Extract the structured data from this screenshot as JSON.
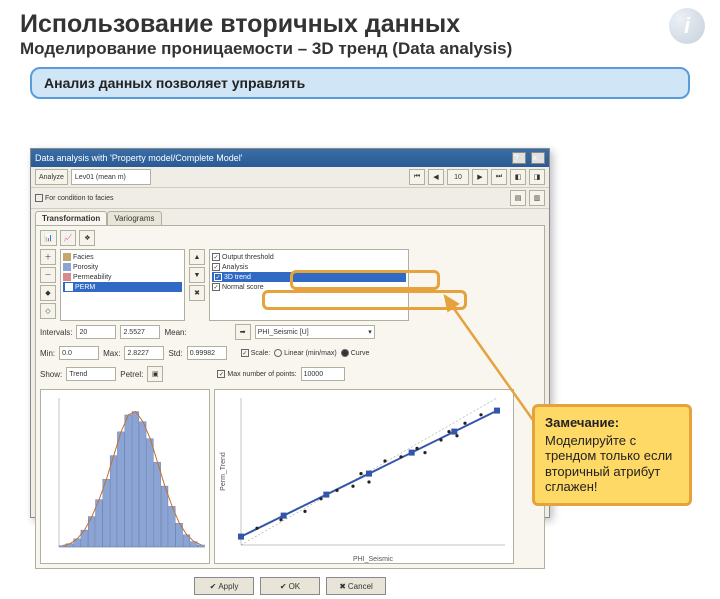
{
  "slide": {
    "title": "Использование вторичных данных",
    "subtitle": "Моделирование проницаемости – 3D тренд (Data analysis)"
  },
  "bluebox": "Анализ данных позволяет управлять",
  "dialog": {
    "title": "Data analysis with 'Property model/Complete Model'",
    "toolbar": {
      "analyze": "Analyze",
      "combo": "Lev01 (mean m)",
      "page": "10"
    },
    "tabs": {
      "transformation": "Transformation",
      "variograms": "Variograms"
    },
    "tree": [
      "Facies",
      "Porosity",
      "Permeability",
      "PERM"
    ],
    "list": {
      "items": [
        "Output threshold",
        "Analysis",
        "3D trend",
        "Normal score"
      ],
      "selected": "3D trend"
    },
    "params": {
      "intervals_label": "Intervals:",
      "intervals": "20",
      "value_label": "",
      "value": "2.5527",
      "mean_label": "Mean:",
      "min_label": "Min:",
      "min": "0.0",
      "max_label": "Max:",
      "max": "2.8227",
      "std_label": "Std:",
      "std": "0.99982",
      "scale_dd": "PHI_Seismic [U]",
      "scale_label": "Scale:",
      "scale_opt1": "Linear (min/max)",
      "scale_opt2": "Curve",
      "max_points_label": "Max number of points:",
      "max_points": "10000",
      "show_label": "Show:",
      "show_value": "Trend",
      "petrel_label": "Petrel:"
    },
    "buttons": {
      "apply": "Apply",
      "ok": "OK",
      "cancel": "Cancel"
    }
  },
  "note": {
    "heading": "Замечание:",
    "body": "Моделируйте с трендом только если вторичный атрибут сглажен!"
  },
  "chart_data": [
    {
      "type": "bar",
      "title": "",
      "xlabel": "",
      "ylabel": "",
      "categories_range": [
        0.0,
        2.8
      ],
      "bins": 20,
      "values": [
        2,
        5,
        12,
        25,
        45,
        70,
        100,
        135,
        170,
        195,
        200,
        185,
        160,
        125,
        90,
        60,
        35,
        18,
        8,
        3
      ],
      "overlay_curve": true,
      "ylim": [
        0,
        220
      ]
    },
    {
      "type": "scatter",
      "title": "",
      "xlabel": "PHI_Seismic",
      "ylabel": "Perm_Trend",
      "x": [
        0.02,
        0.05,
        0.08,
        0.1,
        0.12,
        0.14,
        0.15,
        0.16,
        0.18,
        0.2,
        0.22,
        0.23,
        0.25,
        0.26,
        0.27,
        0.28,
        0.3
      ],
      "y": [
        0.4,
        0.6,
        0.8,
        1.1,
        1.3,
        1.4,
        1.7,
        1.5,
        2.0,
        2.1,
        2.3,
        2.2,
        2.5,
        2.7,
        2.6,
        2.9,
        3.1
      ],
      "trend_line": {
        "x": [
          0.0,
          0.32
        ],
        "y": [
          0.2,
          3.2
        ]
      },
      "reference_line_dashed": {
        "x": [
          0.0,
          0.32
        ],
        "y": [
          0.0,
          3.5
        ]
      },
      "xlim": [
        0,
        0.33
      ],
      "ylim": [
        0,
        3.5
      ]
    }
  ]
}
